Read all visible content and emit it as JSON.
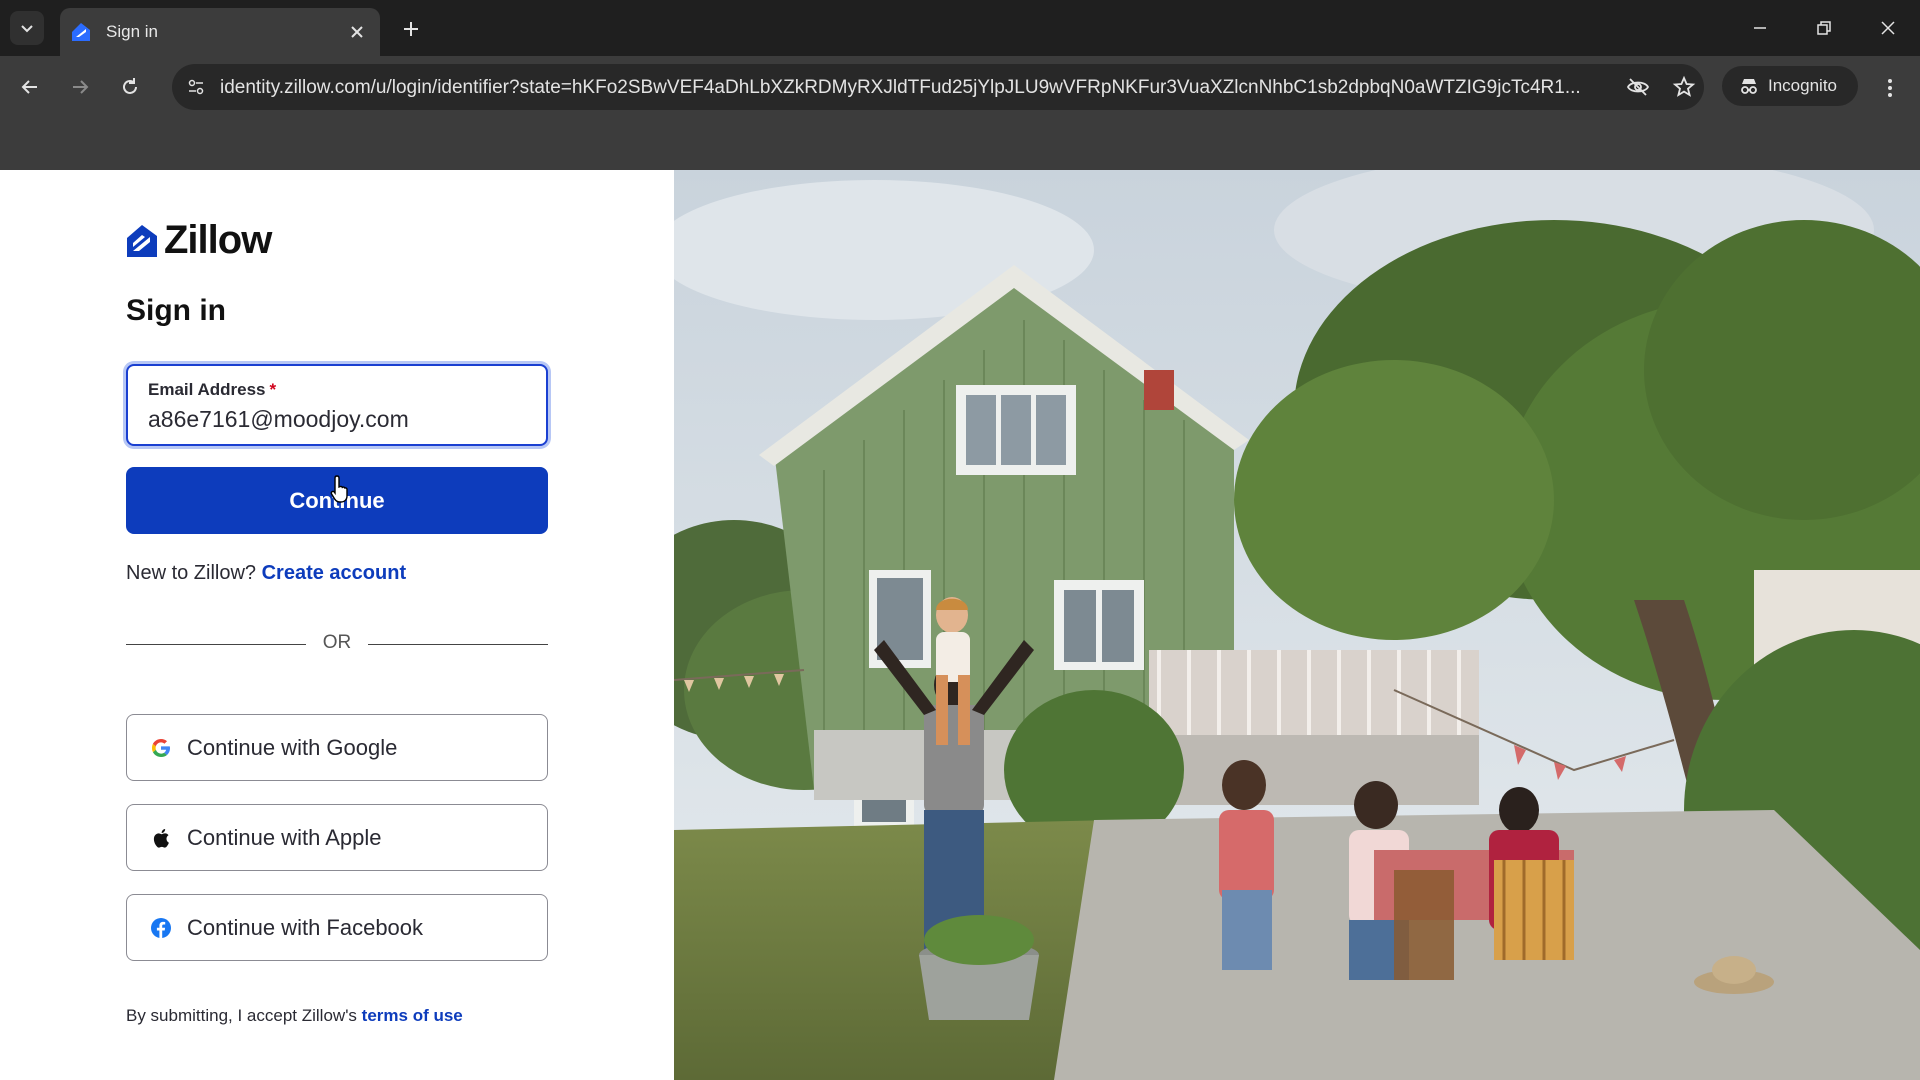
{
  "browser": {
    "tab_title": "Sign in",
    "url": "identity.zillow.com/u/login/identifier?state=hKFo2SBwVEF4aDhLbXZkRDMyRXJldTFud25jYlpJLU9wVFRpNKFur3VuaXZlcnNhbC1sb2dpbqN0aWTZIG9jcTc4R1...",
    "incognito_label": "Incognito"
  },
  "page": {
    "logo_text": "Zillow",
    "heading": "Sign in",
    "email_label": "Email Address",
    "email_required_mark": "*",
    "email_value": "a86e7161@moodjoy.com",
    "continue_label": "Continue",
    "new_prefix": "New to Zillow?",
    "create_account": "Create account",
    "or_text": "OR",
    "google_label": "Continue with Google",
    "apple_label": "Continue with Apple",
    "facebook_label": "Continue with Facebook",
    "terms_prefix": "By submitting, I accept Zillow's",
    "terms_link": "terms of use"
  },
  "colors": {
    "brand_blue": "#0d3cbc",
    "chrome_dark": "#1f1f1f",
    "chrome_toolbar": "#3c3c3c"
  }
}
